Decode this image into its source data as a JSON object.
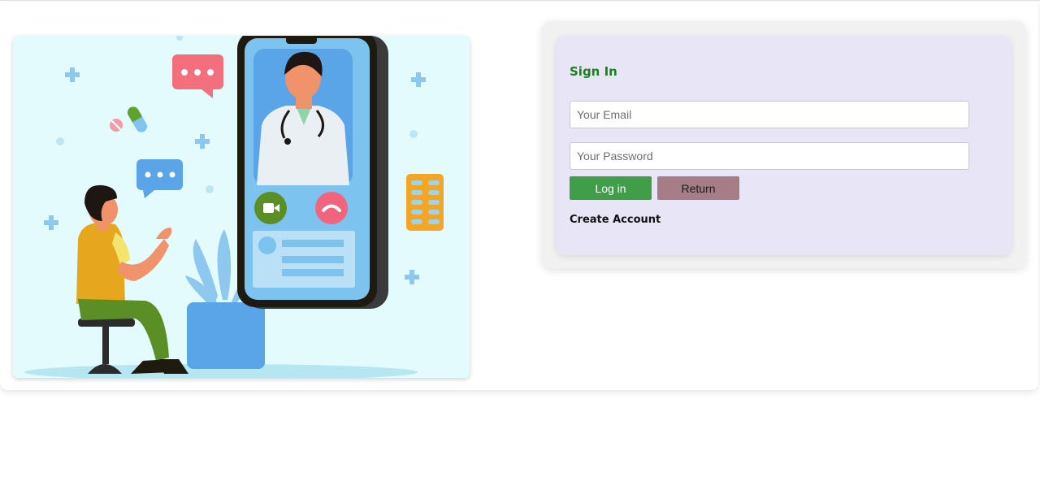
{
  "illustration": {
    "icon": "telemedicine-video-call-illustration"
  },
  "signin": {
    "title": "Sign In",
    "email_placeholder": "Your Email",
    "password_placeholder": "Your Password",
    "login_label": "Log in",
    "return_label": "Return",
    "create_account_label": "Create Account"
  },
  "colors": {
    "title_green": "#1a7f1e",
    "login_button": "#3f9e47",
    "return_button": "#a67d86",
    "panel_background": "#e8e6f6"
  }
}
